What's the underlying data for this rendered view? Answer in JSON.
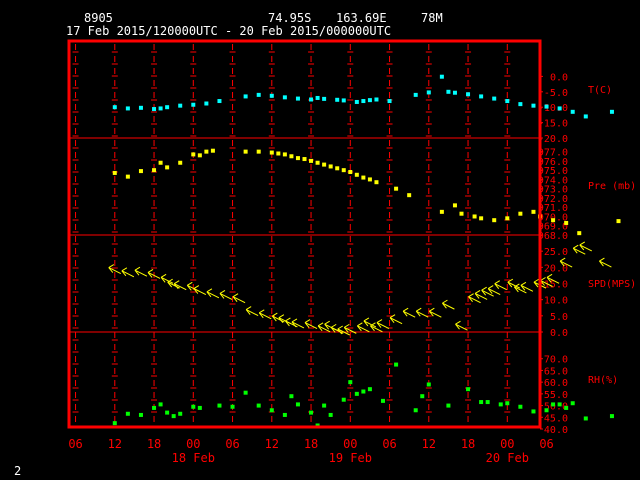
{
  "header": {
    "station_id": "8905",
    "latitude": "74.95S",
    "longitude": "163.69E",
    "elevation": "78M",
    "time_range": "17 Feb 2015/120000UTC - 20 Feb 2015/000000UTC"
  },
  "corner_label": "2",
  "colors": {
    "background": "#000000",
    "frame": "#ff0000",
    "grid": "#ff0000",
    "axis_text": "#ff0000",
    "header_text": "#ffffff",
    "temperature": "#00ffff",
    "pressure": "#ffff00",
    "wind": "#ffff00",
    "humidity": "#00ff00"
  },
  "x_axis": {
    "tick_labels": [
      "06",
      "12",
      "18",
      "00",
      "06",
      "12",
      "18",
      "00",
      "06",
      "12",
      "18",
      "00",
      "06"
    ],
    "tick_hours": [
      -6,
      0,
      6,
      12,
      18,
      24,
      30,
      36,
      42,
      48,
      54,
      60,
      66
    ],
    "date_labels": [
      {
        "text": "18 Feb",
        "hour": 12
      },
      {
        "text": "19 Feb",
        "hour": 36
      },
      {
        "text": "20 Feb",
        "hour": 60
      }
    ],
    "range_hours": [
      -7,
      65
    ],
    "hour_origin": "17 Feb 2015 12:00 UTC"
  },
  "chart_data": [
    {
      "type": "scatter",
      "name": "temperature",
      "label": "T(C)",
      "unit": "C",
      "ylim": [
        -20,
        5
      ],
      "ticks": [
        0,
        -5,
        -10,
        -15,
        -20
      ],
      "tick_labels": [
        "0.0",
        "-5.0",
        "-10.0",
        "-15.0",
        "-20.0"
      ],
      "points": [
        {
          "x": 0,
          "y": -10.0
        },
        {
          "x": 2,
          "y": -10.4
        },
        {
          "x": 4,
          "y": -10.2
        },
        {
          "x": 6,
          "y": -10.6
        },
        {
          "x": 7,
          "y": -10.4
        },
        {
          "x": 8,
          "y": -10.0
        },
        {
          "x": 10,
          "y": -9.5
        },
        {
          "x": 12,
          "y": -9.2
        },
        {
          "x": 14,
          "y": -8.8
        },
        {
          "x": 16,
          "y": -8.0
        },
        {
          "x": 20,
          "y": -6.5
        },
        {
          "x": 22,
          "y": -6.0
        },
        {
          "x": 24,
          "y": -6.3
        },
        {
          "x": 26,
          "y": -6.8
        },
        {
          "x": 28,
          "y": -7.2
        },
        {
          "x": 30,
          "y": -7.5
        },
        {
          "x": 31,
          "y": -7.0
        },
        {
          "x": 32,
          "y": -7.3
        },
        {
          "x": 34,
          "y": -7.6
        },
        {
          "x": 35,
          "y": -7.8
        },
        {
          "x": 37,
          "y": -8.3
        },
        {
          "x": 38,
          "y": -8.0
        },
        {
          "x": 39,
          "y": -7.7
        },
        {
          "x": 40,
          "y": -7.5
        },
        {
          "x": 42,
          "y": -8.0
        },
        {
          "x": 46,
          "y": -6.0
        },
        {
          "x": 48,
          "y": -5.2
        },
        {
          "x": 50,
          "y": -0.1
        },
        {
          "x": 51,
          "y": -5.0
        },
        {
          "x": 52,
          "y": -5.3
        },
        {
          "x": 54,
          "y": -5.8
        },
        {
          "x": 56,
          "y": -6.5
        },
        {
          "x": 58,
          "y": -7.2
        },
        {
          "x": 60,
          "y": -8.0
        },
        {
          "x": 62,
          "y": -9.0
        },
        {
          "x": 64,
          "y": -9.5
        },
        {
          "x": 66,
          "y": -9.8
        },
        {
          "x": 68,
          "y": -10.4
        },
        {
          "x": 70,
          "y": -11.5
        },
        {
          "x": 72,
          "y": -13.0
        },
        {
          "x": 76,
          "y": -11.5
        }
      ]
    },
    {
      "type": "scatter",
      "name": "pressure",
      "label": "Pre (mb)",
      "unit": "mb",
      "ylim": [
        968,
        977.5
      ],
      "ticks": [
        977,
        976,
        975,
        974,
        973,
        972,
        971,
        970,
        969,
        968
      ],
      "tick_labels": [
        "977.0",
        "976.0",
        "975.0",
        "974.0",
        "973.0",
        "972.0",
        "971.0",
        "970.0",
        "969.0",
        "968.0"
      ],
      "points": [
        {
          "x": 0,
          "y": 974.7
        },
        {
          "x": 2,
          "y": 974.3
        },
        {
          "x": 4,
          "y": 974.9
        },
        {
          "x": 6,
          "y": 975.0
        },
        {
          "x": 7,
          "y": 975.8
        },
        {
          "x": 8,
          "y": 975.3
        },
        {
          "x": 10,
          "y": 975.8
        },
        {
          "x": 12,
          "y": 976.7
        },
        {
          "x": 13,
          "y": 976.6
        },
        {
          "x": 14,
          "y": 977.0
        },
        {
          "x": 15,
          "y": 977.1
        },
        {
          "x": 20,
          "y": 977.0
        },
        {
          "x": 22,
          "y": 977.0
        },
        {
          "x": 24,
          "y": 976.9
        },
        {
          "x": 25,
          "y": 976.8
        },
        {
          "x": 26,
          "y": 976.7
        },
        {
          "x": 27,
          "y": 976.5
        },
        {
          "x": 28,
          "y": 976.3
        },
        {
          "x": 29,
          "y": 976.2
        },
        {
          "x": 30,
          "y": 976.0
        },
        {
          "x": 31,
          "y": 975.8
        },
        {
          "x": 32,
          "y": 975.6
        },
        {
          "x": 33,
          "y": 975.4
        },
        {
          "x": 34,
          "y": 975.2
        },
        {
          "x": 35,
          "y": 975.0
        },
        {
          "x": 36,
          "y": 974.8
        },
        {
          "x": 37,
          "y": 974.5
        },
        {
          "x": 38,
          "y": 974.2
        },
        {
          "x": 39,
          "y": 974.0
        },
        {
          "x": 40,
          "y": 973.7
        },
        {
          "x": 43,
          "y": 973.0
        },
        {
          "x": 45,
          "y": 972.3
        },
        {
          "x": 50,
          "y": 970.5
        },
        {
          "x": 52,
          "y": 971.2
        },
        {
          "x": 53,
          "y": 970.3
        },
        {
          "x": 55,
          "y": 970.0
        },
        {
          "x": 56,
          "y": 969.8
        },
        {
          "x": 58,
          "y": 969.6
        },
        {
          "x": 60,
          "y": 969.8
        },
        {
          "x": 62,
          "y": 970.3
        },
        {
          "x": 64,
          "y": 970.5
        },
        {
          "x": 65,
          "y": 970.0
        },
        {
          "x": 67,
          "y": 969.6
        },
        {
          "x": 69,
          "y": 969.3
        },
        {
          "x": 71,
          "y": 968.2
        },
        {
          "x": 77,
          "y": 969.5
        }
      ]
    },
    {
      "type": "scatter",
      "name": "wind",
      "label": "SPD(MPS)",
      "unit": "m/s",
      "ylim": [
        0,
        30
      ],
      "ticks": [
        25,
        20,
        15,
        10,
        5,
        0
      ],
      "tick_labels": [
        "25.0",
        "20.0",
        "15.0",
        "10.0",
        "5.0",
        "0.0"
      ],
      "points": [
        {
          "x": 0,
          "y": 19.0
        },
        {
          "x": 2,
          "y": 18.0
        },
        {
          "x": 4,
          "y": 18.2
        },
        {
          "x": 6,
          "y": 17.5
        },
        {
          "x": 8,
          "y": 16.0
        },
        {
          "x": 9,
          "y": 14.5
        },
        {
          "x": 10,
          "y": 14.0
        },
        {
          "x": 12,
          "y": 13.5
        },
        {
          "x": 13,
          "y": 12.5
        },
        {
          "x": 15,
          "y": 11.5
        },
        {
          "x": 17,
          "y": 11.0
        },
        {
          "x": 19,
          "y": 10.0
        },
        {
          "x": 21,
          "y": 6.0
        },
        {
          "x": 23,
          "y": 5.0
        },
        {
          "x": 25,
          "y": 4.0
        },
        {
          "x": 26,
          "y": 3.5
        },
        {
          "x": 27,
          "y": 2.5
        },
        {
          "x": 28,
          "y": 2.2
        },
        {
          "x": 30,
          "y": 2.0
        },
        {
          "x": 32,
          "y": 1.0
        },
        {
          "x": 33,
          "y": 1.5
        },
        {
          "x": 34,
          "y": 0.5
        },
        {
          "x": 35,
          "y": 0.0
        },
        {
          "x": 36,
          "y": 0.5
        },
        {
          "x": 38,
          "y": 1.0
        },
        {
          "x": 39,
          "y": 2.5
        },
        {
          "x": 40,
          "y": 1.0
        },
        {
          "x": 41,
          "y": 2.0
        },
        {
          "x": 43,
          "y": 3.5
        },
        {
          "x": 45,
          "y": 5.5
        },
        {
          "x": 47,
          "y": 5.5
        },
        {
          "x": 49,
          "y": 5.5
        },
        {
          "x": 51,
          "y": 8.0
        },
        {
          "x": 53,
          "y": 1.5
        },
        {
          "x": 55,
          "y": 10.0
        },
        {
          "x": 56,
          "y": 11.0
        },
        {
          "x": 57,
          "y": 12.0
        },
        {
          "x": 58,
          "y": 12.5
        },
        {
          "x": 59,
          "y": 14.0
        },
        {
          "x": 61,
          "y": 14.5
        },
        {
          "x": 62,
          "y": 13.0
        },
        {
          "x": 63,
          "y": 13.5
        },
        {
          "x": 65,
          "y": 14.5
        },
        {
          "x": 66,
          "y": 15.0
        },
        {
          "x": 67,
          "y": 16.0
        },
        {
          "x": 69,
          "y": 21.0
        },
        {
          "x": 71,
          "y": 25.0
        },
        {
          "x": 72,
          "y": 26.0
        },
        {
          "x": 75,
          "y": 21.0
        }
      ]
    },
    {
      "type": "scatter",
      "name": "humidity",
      "label": "RH(%)",
      "unit": "%",
      "ylim": [
        40,
        75
      ],
      "ticks": [
        70,
        65,
        60,
        55,
        50,
        45,
        40
      ],
      "tick_labels": [
        "70.0",
        "65.0",
        "60.0",
        "55.0",
        "50.0",
        "45.0",
        "40.0"
      ],
      "points": [
        {
          "x": 0,
          "y": 42.5
        },
        {
          "x": 2,
          "y": 46.5
        },
        {
          "x": 4,
          "y": 46.0
        },
        {
          "x": 6,
          "y": 49.0
        },
        {
          "x": 7,
          "y": 50.5
        },
        {
          "x": 8,
          "y": 47.0
        },
        {
          "x": 9,
          "y": 45.5
        },
        {
          "x": 10,
          "y": 46.5
        },
        {
          "x": 12,
          "y": 49.5
        },
        {
          "x": 13,
          "y": 49.0
        },
        {
          "x": 16,
          "y": 50.0
        },
        {
          "x": 18,
          "y": 49.5
        },
        {
          "x": 20,
          "y": 55.5
        },
        {
          "x": 22,
          "y": 50.0
        },
        {
          "x": 24,
          "y": 48.0
        },
        {
          "x": 26,
          "y": 46.0
        },
        {
          "x": 27,
          "y": 54.0
        },
        {
          "x": 28,
          "y": 50.5
        },
        {
          "x": 30,
          "y": 47.0
        },
        {
          "x": 31,
          "y": 41.5
        },
        {
          "x": 32,
          "y": 50.0
        },
        {
          "x": 33,
          "y": 46.0
        },
        {
          "x": 35,
          "y": 52.5
        },
        {
          "x": 36,
          "y": 60.0
        },
        {
          "x": 37,
          "y": 55.0
        },
        {
          "x": 38,
          "y": 56.0
        },
        {
          "x": 39,
          "y": 57.0
        },
        {
          "x": 41,
          "y": 52.0
        },
        {
          "x": 43,
          "y": 67.5
        },
        {
          "x": 46,
          "y": 48.0
        },
        {
          "x": 47,
          "y": 54.0
        },
        {
          "x": 48,
          "y": 59.0
        },
        {
          "x": 51,
          "y": 50.0
        },
        {
          "x": 54,
          "y": 57.0
        },
        {
          "x": 56,
          "y": 51.5
        },
        {
          "x": 57,
          "y": 51.5
        },
        {
          "x": 59,
          "y": 50.5
        },
        {
          "x": 60,
          "y": 51.0
        },
        {
          "x": 62,
          "y": 49.5
        },
        {
          "x": 64,
          "y": 47.5
        },
        {
          "x": 66,
          "y": 48.0
        },
        {
          "x": 67,
          "y": 50.5
        },
        {
          "x": 68,
          "y": 50.5
        },
        {
          "x": 69,
          "y": 49.0
        },
        {
          "x": 70,
          "y": 51.0
        },
        {
          "x": 72,
          "y": 44.5
        },
        {
          "x": 76,
          "y": 45.5
        }
      ]
    }
  ]
}
